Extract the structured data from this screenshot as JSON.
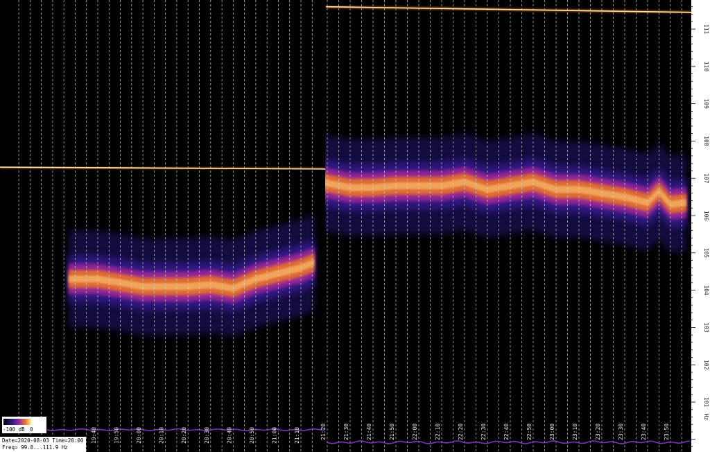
{
  "chart_data": {
    "type": "heatmap",
    "title": "",
    "x_ticks": [
      "19:40",
      "19:50",
      "20:00",
      "20:10",
      "20:20",
      "20:30",
      "20:40",
      "20:50",
      "21:00",
      "21:10",
      "21:20",
      "21:30",
      "21:40",
      "21:50",
      "22:00",
      "22:10",
      "22:20",
      "22:30",
      "22:40",
      "22:50",
      "23:00",
      "23:10",
      "23:20",
      "23:30",
      "23:40",
      "23:50"
    ],
    "y_ticks": [
      "101",
      "102",
      "103",
      "104",
      "105",
      "106",
      "107",
      "108",
      "109",
      "110",
      "111"
    ],
    "y_unit_label": "Hz",
    "ylim": [
      99.8,
      111.9
    ],
    "colorbar": {
      "min_label": "-100 dB",
      "max_label": "0"
    },
    "info": {
      "date_line": "Date=2020-08-03 Time=20:00",
      "freq_line": "Freq= 99.8...111.9 Hz"
    },
    "series": [
      {
        "segment": "left",
        "kind": "tone",
        "t": [
          "19:27",
          "21:16"
        ],
        "f": [
          107.3,
          107.25
        ]
      },
      {
        "segment": "right",
        "kind": "tone",
        "t": [
          "21:17",
          "23:57"
        ],
        "f": [
          111.6,
          111.45
        ]
      },
      {
        "segment": "left",
        "kind": "band",
        "t": [
          "19:27",
          "19:40",
          "19:50",
          "20:00",
          "20:10",
          "20:20",
          "20:30",
          "20:40",
          "20:50",
          "21:00",
          "21:10",
          "21:16"
        ],
        "f": [
          104.3,
          104.3,
          104.2,
          104.1,
          104.1,
          104.1,
          104.15,
          104.05,
          104.3,
          104.45,
          104.6,
          104.75
        ]
      },
      {
        "segment": "right",
        "kind": "band",
        "t": [
          "21:17",
          "21:30",
          "21:40",
          "21:50",
          "22:00",
          "22:10",
          "22:20",
          "22:30",
          "22:40",
          "22:50",
          "23:00",
          "23:10",
          "23:20",
          "23:30",
          "23:40",
          "23:45",
          "23:50",
          "23:57"
        ],
        "f": [
          106.9,
          106.75,
          106.75,
          106.8,
          106.8,
          106.8,
          106.9,
          106.7,
          106.8,
          106.9,
          106.7,
          106.7,
          106.6,
          106.5,
          106.35,
          106.65,
          106.3,
          106.35
        ]
      }
    ],
    "colors": {
      "background": "#000000",
      "hot": "#ffd27a",
      "warm": "#e8742a",
      "mid": "#a0289a",
      "cool": "#2a1a8a",
      "trace": "#8a3ad0"
    }
  }
}
